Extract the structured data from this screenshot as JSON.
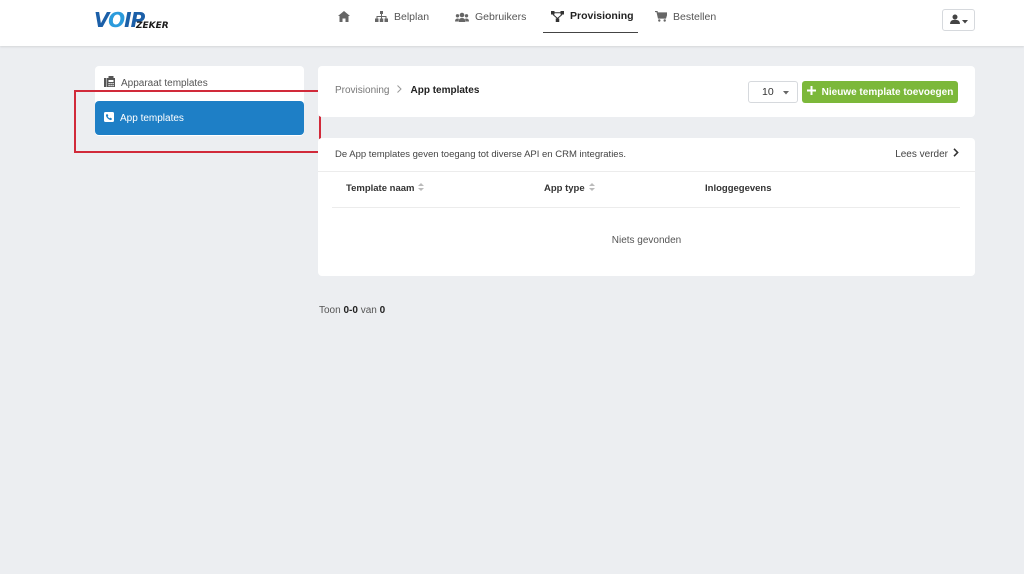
{
  "brand": {
    "logo_main": "VOIP",
    "logo_sub": "ZEKER"
  },
  "nav": {
    "items": [
      {
        "label": "",
        "icon": "home-icon"
      },
      {
        "label": "Belplan",
        "icon": "sitemap-icon"
      },
      {
        "label": "Gebruikers",
        "icon": "users-icon"
      },
      {
        "label": "Provisioning",
        "icon": "network-icon",
        "active": true
      },
      {
        "label": "Bestellen",
        "icon": "cart-icon"
      }
    ]
  },
  "user_menu": {
    "icon": "user-icon"
  },
  "sidebar": {
    "items": [
      {
        "label": "Apparaat templates",
        "icon": "fax-icon"
      },
      {
        "label": "App templates",
        "icon": "phone-square-icon",
        "active": true
      }
    ]
  },
  "breadcrumb": {
    "parent": "Provisioning",
    "current": "App templates"
  },
  "toolbar": {
    "per_page": "10",
    "add_label": "Nieuwe template toevoegen"
  },
  "info": {
    "text": "De App templates geven toegang tot diverse API en CRM integraties.",
    "read_more": "Lees verder"
  },
  "table": {
    "columns": [
      "Template naam",
      "App type",
      "Inloggegevens"
    ],
    "empty_text": "Niets gevonden"
  },
  "footer": {
    "prefix": "Toon",
    "range_start": "0",
    "range_end": "0",
    "of": "van",
    "total": "0"
  },
  "colors": {
    "primary": "#1e7fc6",
    "success": "#7cb83a",
    "highlight": "#d12a3a",
    "background": "#eceef1"
  }
}
